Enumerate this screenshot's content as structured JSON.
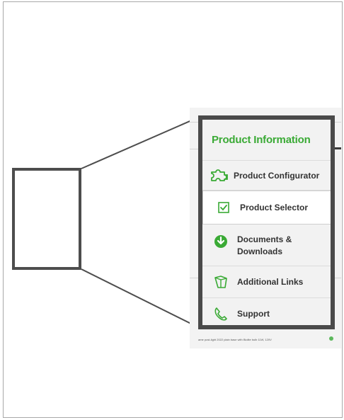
{
  "menu": {
    "title": "Product Information",
    "items": [
      {
        "label": "Product Configurator",
        "icon": "puzzle-icon"
      },
      {
        "label": "Product Selector",
        "icon": "checkbox-icon",
        "selected": true
      },
      {
        "label": "Documents & Downloads",
        "icon": "download-icon"
      },
      {
        "label": "Additional Links",
        "icon": "box-link-icon"
      },
      {
        "label": "Support",
        "icon": "phone-icon"
      }
    ]
  },
  "background": {
    "row_text": "ame post-light 2022 plain base with Biolite bulb 11W, 120V"
  },
  "colors": {
    "accent_green": "#3aaa35",
    "border_dark": "#4a4a4a"
  }
}
